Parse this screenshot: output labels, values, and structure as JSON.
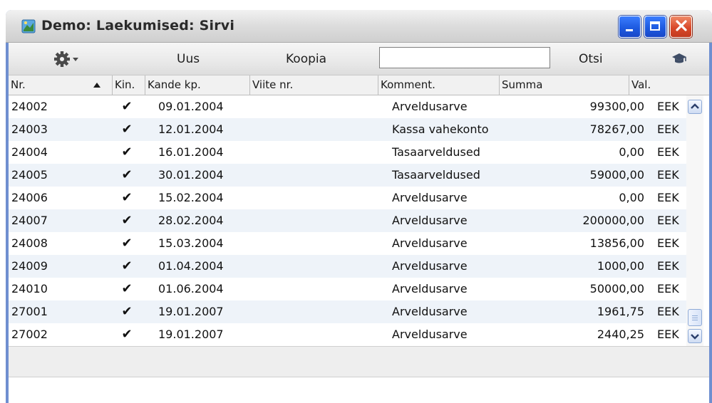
{
  "window": {
    "title": "Demo: Laekumised: Sirvi",
    "title_bar_color": "#dcdcdc",
    "frame_color": "#6f8fd0",
    "controls": {
      "minimize": "minimize-icon",
      "maximize": "maximize-icon",
      "close": "close-icon"
    }
  },
  "toolbar": {
    "actions_icon": "gear-icon",
    "new_label": "Uus",
    "copy_label": "Koopia",
    "search_value": "",
    "search_label": "Otsi",
    "help_icon": "graduation-cap-icon"
  },
  "table": {
    "columns": [
      "Nr.",
      "Kin.",
      "Kande kp.",
      "Viite nr.",
      "Komment.",
      "Summa",
      "Val."
    ],
    "sorted_by": "Nr.",
    "sort_direction": "ascending",
    "rows": [
      {
        "nr": "24002",
        "kin": "✔",
        "date": "09.01.2004",
        "ref": "",
        "comment": "Arveldusarve",
        "sum": "99300,00",
        "cur": "EEK"
      },
      {
        "nr": "24003",
        "kin": "✔",
        "date": "12.01.2004",
        "ref": "",
        "comment": "Kassa vahekonto",
        "sum": "78267,00",
        "cur": "EEK"
      },
      {
        "nr": "24004",
        "kin": "✔",
        "date": "16.01.2004",
        "ref": "",
        "comment": "Tasaarveldused",
        "sum": "0,00",
        "cur": "EEK"
      },
      {
        "nr": "24005",
        "kin": "✔",
        "date": "30.01.2004",
        "ref": "",
        "comment": "Tasaarveldused",
        "sum": "59000,00",
        "cur": "EEK"
      },
      {
        "nr": "24006",
        "kin": "✔",
        "date": "15.02.2004",
        "ref": "",
        "comment": "Arveldusarve",
        "sum": "0,00",
        "cur": "EEK"
      },
      {
        "nr": "24007",
        "kin": "✔",
        "date": "28.02.2004",
        "ref": "",
        "comment": "Arveldusarve",
        "sum": "200000,00",
        "cur": "EEK"
      },
      {
        "nr": "24008",
        "kin": "✔",
        "date": "15.03.2004",
        "ref": "",
        "comment": "Arveldusarve",
        "sum": "13856,00",
        "cur": "EEK"
      },
      {
        "nr": "24009",
        "kin": "✔",
        "date": "01.04.2004",
        "ref": "",
        "comment": "Arveldusarve",
        "sum": "1000,00",
        "cur": "EEK"
      },
      {
        "nr": "24010",
        "kin": "✔",
        "date": "01.06.2004",
        "ref": "",
        "comment": "Arveldusarve",
        "sum": "50000,00",
        "cur": "EEK"
      },
      {
        "nr": "27001",
        "kin": "✔",
        "date": "19.01.2007",
        "ref": "",
        "comment": "Arveldusarve",
        "sum": "1961,75",
        "cur": "EEK"
      },
      {
        "nr": "27002",
        "kin": "✔",
        "date": "19.01.2007",
        "ref": "",
        "comment": "Arveldusarve",
        "sum": "2440,25",
        "cur": "EEK"
      }
    ]
  },
  "scrollbar": {
    "position": "bottom"
  }
}
